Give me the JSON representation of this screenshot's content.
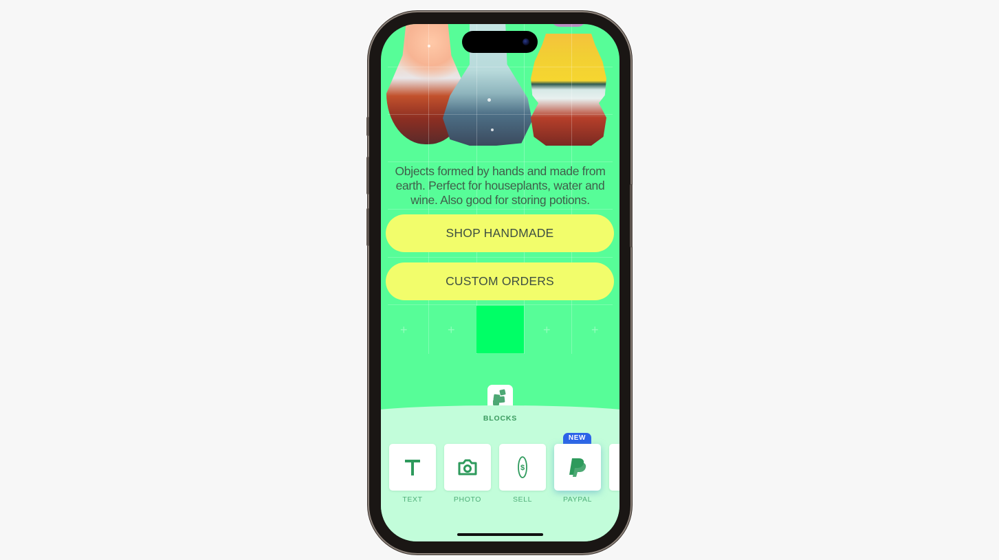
{
  "app": {
    "device": "iPhone",
    "accent_color": "#57fd98",
    "button_color": "#f2fd6b",
    "tray_color": "#c2fdda",
    "icon_color": "#2e9a5c",
    "badge_color": "#2c63e8"
  },
  "canvas": {
    "hero_image": "ceramic-vases",
    "description": "Objects formed by hands and made from earth. Perfect for houseplants, water and wine. Also good for storing potions.",
    "buttons": [
      {
        "label": "SHOP HANDMADE"
      },
      {
        "label": "CUSTOM ORDERS"
      }
    ],
    "add_slots": [
      "+",
      "+",
      "+",
      "+"
    ]
  },
  "tray": {
    "section_label": "BLOCKS",
    "section_icon": "blocks-icon",
    "items": [
      {
        "label": "TEXT",
        "icon": "text-icon"
      },
      {
        "label": "PHOTO",
        "icon": "camera-icon"
      },
      {
        "label": "SELL",
        "icon": "dollar-coin-icon"
      },
      {
        "label": "PAYPAL",
        "icon": "paypal-icon",
        "badge": "NEW",
        "selected": true
      }
    ]
  }
}
